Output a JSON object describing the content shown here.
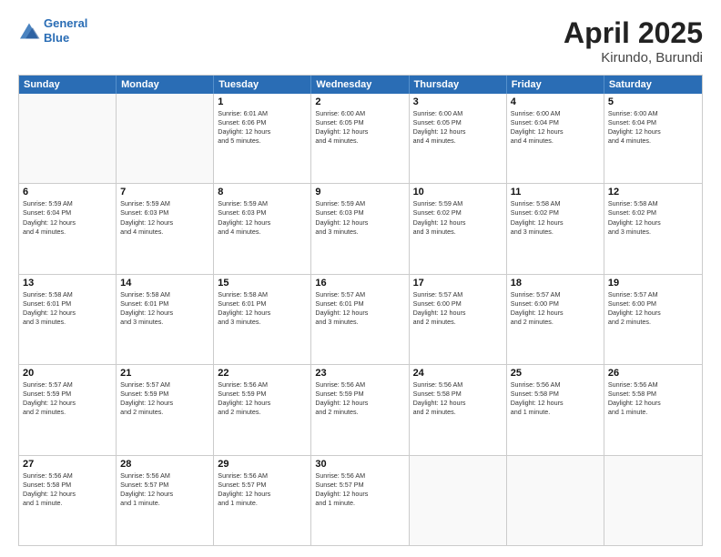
{
  "logo": {
    "line1": "General",
    "line2": "Blue"
  },
  "title": "April 2025",
  "subtitle": "Kirundo, Burundi",
  "days": [
    "Sunday",
    "Monday",
    "Tuesday",
    "Wednesday",
    "Thursday",
    "Friday",
    "Saturday"
  ],
  "rows": [
    [
      {
        "day": "",
        "info": ""
      },
      {
        "day": "",
        "info": ""
      },
      {
        "day": "1",
        "info": "Sunrise: 6:01 AM\nSunset: 6:06 PM\nDaylight: 12 hours\nand 5 minutes."
      },
      {
        "day": "2",
        "info": "Sunrise: 6:00 AM\nSunset: 6:05 PM\nDaylight: 12 hours\nand 4 minutes."
      },
      {
        "day": "3",
        "info": "Sunrise: 6:00 AM\nSunset: 6:05 PM\nDaylight: 12 hours\nand 4 minutes."
      },
      {
        "day": "4",
        "info": "Sunrise: 6:00 AM\nSunset: 6:04 PM\nDaylight: 12 hours\nand 4 minutes."
      },
      {
        "day": "5",
        "info": "Sunrise: 6:00 AM\nSunset: 6:04 PM\nDaylight: 12 hours\nand 4 minutes."
      }
    ],
    [
      {
        "day": "6",
        "info": "Sunrise: 5:59 AM\nSunset: 6:04 PM\nDaylight: 12 hours\nand 4 minutes."
      },
      {
        "day": "7",
        "info": "Sunrise: 5:59 AM\nSunset: 6:03 PM\nDaylight: 12 hours\nand 4 minutes."
      },
      {
        "day": "8",
        "info": "Sunrise: 5:59 AM\nSunset: 6:03 PM\nDaylight: 12 hours\nand 4 minutes."
      },
      {
        "day": "9",
        "info": "Sunrise: 5:59 AM\nSunset: 6:03 PM\nDaylight: 12 hours\nand 3 minutes."
      },
      {
        "day": "10",
        "info": "Sunrise: 5:59 AM\nSunset: 6:02 PM\nDaylight: 12 hours\nand 3 minutes."
      },
      {
        "day": "11",
        "info": "Sunrise: 5:58 AM\nSunset: 6:02 PM\nDaylight: 12 hours\nand 3 minutes."
      },
      {
        "day": "12",
        "info": "Sunrise: 5:58 AM\nSunset: 6:02 PM\nDaylight: 12 hours\nand 3 minutes."
      }
    ],
    [
      {
        "day": "13",
        "info": "Sunrise: 5:58 AM\nSunset: 6:01 PM\nDaylight: 12 hours\nand 3 minutes."
      },
      {
        "day": "14",
        "info": "Sunrise: 5:58 AM\nSunset: 6:01 PM\nDaylight: 12 hours\nand 3 minutes."
      },
      {
        "day": "15",
        "info": "Sunrise: 5:58 AM\nSunset: 6:01 PM\nDaylight: 12 hours\nand 3 minutes."
      },
      {
        "day": "16",
        "info": "Sunrise: 5:57 AM\nSunset: 6:01 PM\nDaylight: 12 hours\nand 3 minutes."
      },
      {
        "day": "17",
        "info": "Sunrise: 5:57 AM\nSunset: 6:00 PM\nDaylight: 12 hours\nand 2 minutes."
      },
      {
        "day": "18",
        "info": "Sunrise: 5:57 AM\nSunset: 6:00 PM\nDaylight: 12 hours\nand 2 minutes."
      },
      {
        "day": "19",
        "info": "Sunrise: 5:57 AM\nSunset: 6:00 PM\nDaylight: 12 hours\nand 2 minutes."
      }
    ],
    [
      {
        "day": "20",
        "info": "Sunrise: 5:57 AM\nSunset: 5:59 PM\nDaylight: 12 hours\nand 2 minutes."
      },
      {
        "day": "21",
        "info": "Sunrise: 5:57 AM\nSunset: 5:59 PM\nDaylight: 12 hours\nand 2 minutes."
      },
      {
        "day": "22",
        "info": "Sunrise: 5:56 AM\nSunset: 5:59 PM\nDaylight: 12 hours\nand 2 minutes."
      },
      {
        "day": "23",
        "info": "Sunrise: 5:56 AM\nSunset: 5:59 PM\nDaylight: 12 hours\nand 2 minutes."
      },
      {
        "day": "24",
        "info": "Sunrise: 5:56 AM\nSunset: 5:58 PM\nDaylight: 12 hours\nand 2 minutes."
      },
      {
        "day": "25",
        "info": "Sunrise: 5:56 AM\nSunset: 5:58 PM\nDaylight: 12 hours\nand 1 minute."
      },
      {
        "day": "26",
        "info": "Sunrise: 5:56 AM\nSunset: 5:58 PM\nDaylight: 12 hours\nand 1 minute."
      }
    ],
    [
      {
        "day": "27",
        "info": "Sunrise: 5:56 AM\nSunset: 5:58 PM\nDaylight: 12 hours\nand 1 minute."
      },
      {
        "day": "28",
        "info": "Sunrise: 5:56 AM\nSunset: 5:57 PM\nDaylight: 12 hours\nand 1 minute."
      },
      {
        "day": "29",
        "info": "Sunrise: 5:56 AM\nSunset: 5:57 PM\nDaylight: 12 hours\nand 1 minute."
      },
      {
        "day": "30",
        "info": "Sunrise: 5:56 AM\nSunset: 5:57 PM\nDaylight: 12 hours\nand 1 minute."
      },
      {
        "day": "",
        "info": ""
      },
      {
        "day": "",
        "info": ""
      },
      {
        "day": "",
        "info": ""
      }
    ]
  ]
}
